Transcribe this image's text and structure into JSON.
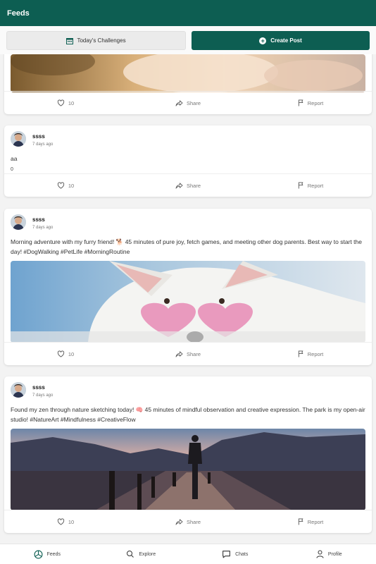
{
  "app": {
    "title": "Feeds"
  },
  "actions": {
    "challenges_label": "Today's Challenges",
    "create_label": "Create Post"
  },
  "labels": {
    "share": "Share",
    "report": "Report"
  },
  "posts": [
    {
      "like_count": "10"
    },
    {
      "username": "ssss",
      "time": "7 days ago",
      "content": "aa",
      "extra_value": "0",
      "like_count": "10"
    },
    {
      "username": "ssss",
      "time": "7 days ago",
      "content": "Morning adventure with my furry friend! 🐕 45 minutes of pure joy, fetch games, and meeting other dog parents. Best way to start the day! #DogWalking #PetLife #MorningRoutine",
      "like_count": "10"
    },
    {
      "username": "ssss",
      "time": "7 days ago",
      "content": "Found my zen through nature sketching today! 🧠 45 minutes of mindful observation and creative expression. The park is my open-air studio! #NatureArt #Mindfulness #CreativeFlow",
      "like_count": "10"
    }
  ],
  "nav": {
    "feeds": "Feeds",
    "explore": "Explore",
    "chats": "Chats",
    "profile": "Profile"
  },
  "colors": {
    "primary": "#0d5e52"
  }
}
